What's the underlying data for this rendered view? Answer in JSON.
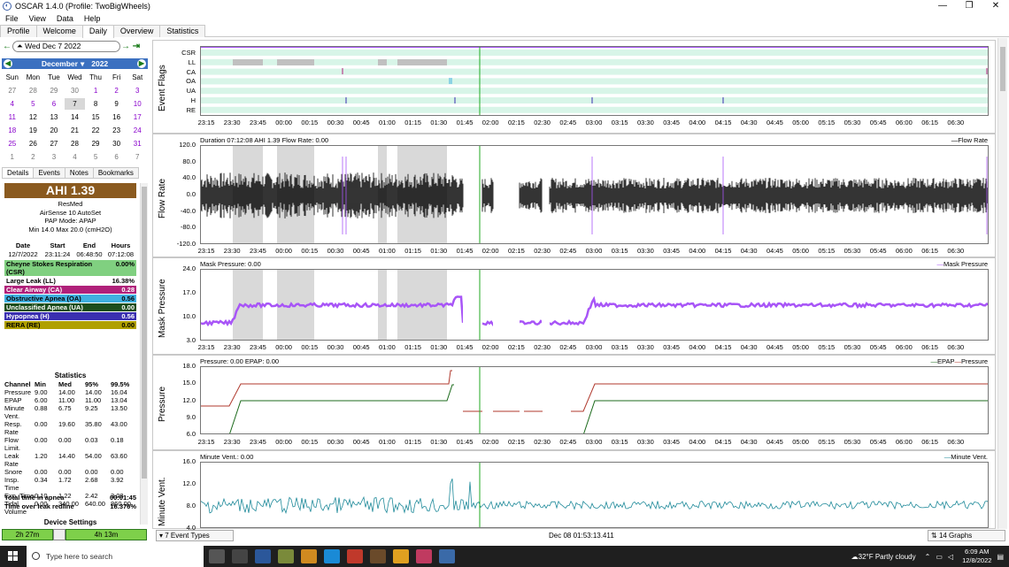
{
  "window": {
    "title": "OSCAR 1.4.0 (Profile: TwoBigWheels)",
    "app_icon": "oscar-icon"
  },
  "menu": [
    "File",
    "View",
    "Data",
    "Help"
  ],
  "tabs": [
    "Profile",
    "Welcome",
    "Daily",
    "Overview",
    "Statistics"
  ],
  "active_tab": "Daily",
  "date_nav": {
    "date": "Wed Dec 7 2022"
  },
  "calendar": {
    "month": "December",
    "year": "2022",
    "dow": [
      "Sun",
      "Mon",
      "Tue",
      "Wed",
      "Thu",
      "Fri",
      "Sat"
    ],
    "weeks": [
      [
        "27",
        "28",
        "29",
        "30",
        "1",
        "2",
        "3"
      ],
      [
        "4",
        "5",
        "6",
        "7",
        "8",
        "9",
        "10"
      ],
      [
        "11",
        "12",
        "13",
        "14",
        "15",
        "16",
        "17"
      ],
      [
        "18",
        "19",
        "20",
        "21",
        "22",
        "23",
        "24"
      ],
      [
        "25",
        "26",
        "27",
        "28",
        "29",
        "30",
        "31"
      ],
      [
        "1",
        "2",
        "3",
        "4",
        "5",
        "6",
        "7"
      ]
    ],
    "selected": "7"
  },
  "subtabs": [
    "Details",
    "Events",
    "Notes",
    "Bookmarks"
  ],
  "details": {
    "ahi": "AHI 1.39",
    "device_lines": [
      "ResMed",
      "AirSense 10 AutoSet",
      "PAP Mode: APAP",
      "Min 14.0 Max 20.0 (cmH2O)"
    ],
    "session_header": [
      "Date",
      "Start",
      "End",
      "Hours"
    ],
    "session_row": [
      "12/7/2022",
      "23:11:24",
      "06:48:50",
      "07:12:08"
    ],
    "events": [
      {
        "name": "Cheyne Stokes Respiration (CSR)",
        "value": "0.00%",
        "color": "#80d080"
      },
      {
        "name": "Large Leak (LL)",
        "value": "16.38%",
        "color": "#bdbdbd"
      },
      {
        "name": "Clear Airway (CA)",
        "value": "0.28",
        "color": "#b0207a"
      },
      {
        "name": "Obstructive Apnea (OA)",
        "value": "0.56",
        "color": "#40b0e0"
      },
      {
        "name": "Unclassified Apnea (UA)",
        "value": "0.00",
        "color": "#1c4d1c"
      },
      {
        "name": "Hypopnea (H)",
        "value": "0.56",
        "color": "#3a2fb0"
      },
      {
        "name": "RERA (RE)",
        "value": "0.00",
        "color": "#b0a000"
      }
    ],
    "stats_title": "Statistics",
    "stats_header": [
      "Channel",
      "Min",
      "Med",
      "95%",
      "99.5%"
    ],
    "stats": [
      [
        "Pressure",
        "9.00",
        "14.00",
        "14.00",
        "16.04"
      ],
      [
        "EPAP",
        "6.00",
        "11.00",
        "11.00",
        "13.04"
      ],
      [
        "Minute Vent.",
        "0.88",
        "6.75",
        "9.25",
        "13.50"
      ],
      [
        "Resp. Rate",
        "0.00",
        "19.60",
        "35.80",
        "43.00"
      ],
      [
        "Flow Limit.",
        "0.00",
        "0.00",
        "0.03",
        "0.18"
      ],
      [
        "Leak Rate",
        "1.20",
        "14.40",
        "54.00",
        "63.60"
      ],
      [
        "Snore",
        "0.00",
        "0.00",
        "0.00",
        "0.00"
      ],
      [
        "Insp. Time",
        "0.34",
        "1.72",
        "2.68",
        "3.92"
      ],
      [
        "Exp. Time",
        "0.10",
        "1.22",
        "2.42",
        "3.08"
      ],
      [
        "Tidal Volume",
        "0.00",
        "340.00",
        "640.00",
        "860.00"
      ]
    ],
    "totals": [
      {
        "label": "Total time in apnea",
        "value": "00:01:45"
      },
      {
        "label": "Time over leak redline",
        "value": "16.376%"
      }
    ],
    "device_settings": "Device Settings"
  },
  "duration_bar": {
    "left": "2h 27m",
    "right": "4h 13m"
  },
  "xticks": [
    "23:15",
    "23:30",
    "23:45",
    "00:00",
    "00:15",
    "00:30",
    "00:45",
    "01:00",
    "01:15",
    "01:30",
    "01:45",
    "02:00",
    "02:15",
    "02:30",
    "02:45",
    "03:00",
    "03:15",
    "03:30",
    "03:45",
    "04:00",
    "04:15",
    "04:30",
    "04:45",
    "05:00",
    "05:15",
    "05:30",
    "05:45",
    "06:00",
    "06:15",
    "06:30"
  ],
  "graphs": {
    "event_flags": {
      "label": "Event Flags",
      "rows": [
        "CSR",
        "LL",
        "CA",
        "OA",
        "UA",
        "H",
        "RE"
      ]
    },
    "flow_rate": {
      "label": "Flow Rate",
      "info": "Duration 07:12:08 AHI 1.39 Flow Rate: 0.00",
      "legend": "Flow Rate",
      "yticks": [
        "120.0",
        "80.0",
        "40.0",
        "0.0",
        "-40.0",
        "-80.0",
        "-120.0"
      ],
      "color": "#000000"
    },
    "mask_pressure": {
      "label": "Mask Pressure",
      "info": "Mask Pressure: 0.00",
      "legend": "Mask Pressure",
      "yticks": [
        "24.0",
        "17.0",
        "10.0",
        "3.0"
      ],
      "color": "#a855f7"
    },
    "pressure": {
      "label": "Pressure",
      "info": "Pressure: 0.00 EPAP: 0.00",
      "legend": "EPAP",
      "legend2": "Pressure",
      "yticks": [
        "18.0",
        "15.0",
        "12.0",
        "9.0",
        "6.0"
      ],
      "color": "#b03a2e",
      "color2": "#1c6b1c"
    },
    "minute_vent": {
      "label": "Minute Vent.",
      "info": "Minute Vent.: 0.00",
      "legend": "Minute Vent.",
      "yticks": [
        "16.0",
        "12.0",
        "8.0",
        "4.0"
      ],
      "color": "#1f8a9a"
    }
  },
  "statusbar": {
    "event_types": "7 Event Types",
    "cursor_time": "Dec 08 01:53:13.411",
    "graphs": "14 Graphs"
  },
  "taskbar": {
    "search": "Type here to search",
    "weather": "32°F Partly cloudy",
    "time": "6:09 AM",
    "date": "12/8/2022"
  }
}
